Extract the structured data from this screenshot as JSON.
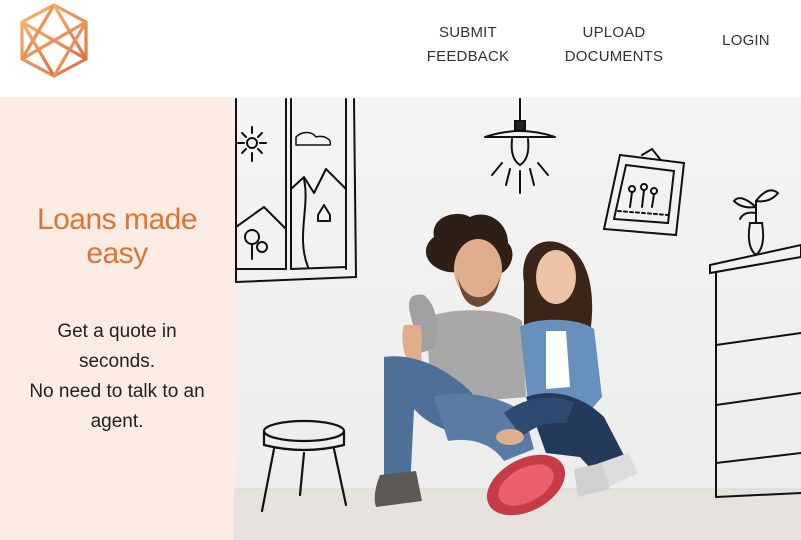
{
  "header": {
    "logo_icon": "geometric-cube-logo-icon",
    "nav": {
      "submit_feedback": [
        "SUBMIT",
        "FEEDBACK"
      ],
      "upload_documents": [
        "UPLOAD",
        "DOCUMENTS"
      ],
      "login": "LOGIN"
    }
  },
  "hero": {
    "headline": [
      "Loans made",
      "easy"
    ],
    "subcopy": [
      "Get a quote in",
      "seconds.",
      "No need to talk to an",
      "agent."
    ],
    "image": "couple-sitting-floor-with-sketched-furniture-photo"
  },
  "colors": {
    "accent": "#dc7433",
    "panel_background": "#fdece3",
    "nav_text": "#333333"
  }
}
